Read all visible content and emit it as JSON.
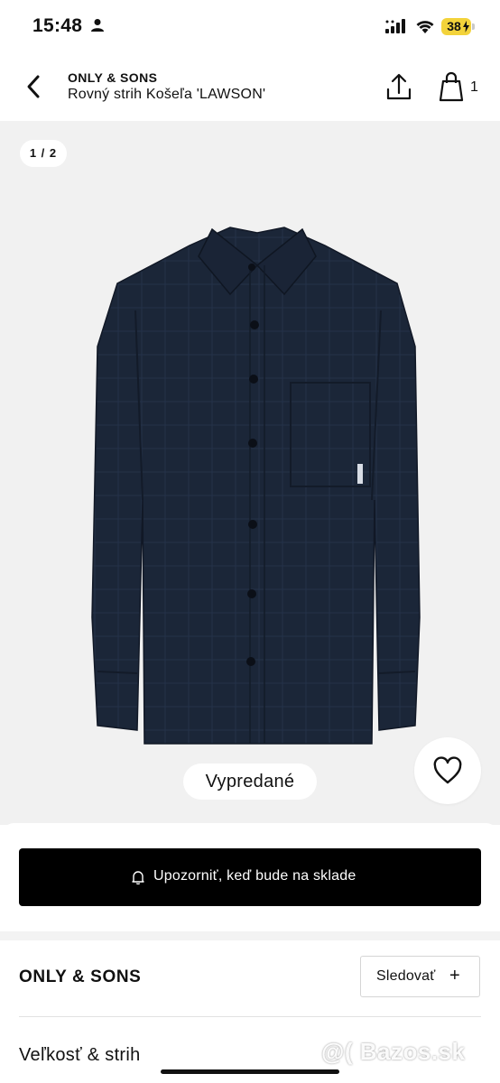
{
  "status_bar": {
    "time": "15:48",
    "battery": "38",
    "battery_color": "#f3d33b"
  },
  "header": {
    "brand": "ONLY & SONS",
    "title": "Rovný strih Košeľa 'LAWSON'",
    "bag_count": "1",
    "icons": [
      "chevron-left-icon",
      "share-icon",
      "shopping-bag-icon"
    ]
  },
  "gallery": {
    "photo_counter": "1 / 2",
    "soldout_label": "Vypredané",
    "background": "#f1f1f1"
  },
  "actions": {
    "notify_label": "Upozorniť, keď bude na sklade",
    "notify_bg": "#000000"
  },
  "brand_section": {
    "brand_name": "ONLY & SONS",
    "follow_label": "Sledovať",
    "follow_icon": "+"
  },
  "size_section": {
    "label": "Veľkosť & strih"
  },
  "watermark": {
    "text": "@( Bazos.sk"
  }
}
